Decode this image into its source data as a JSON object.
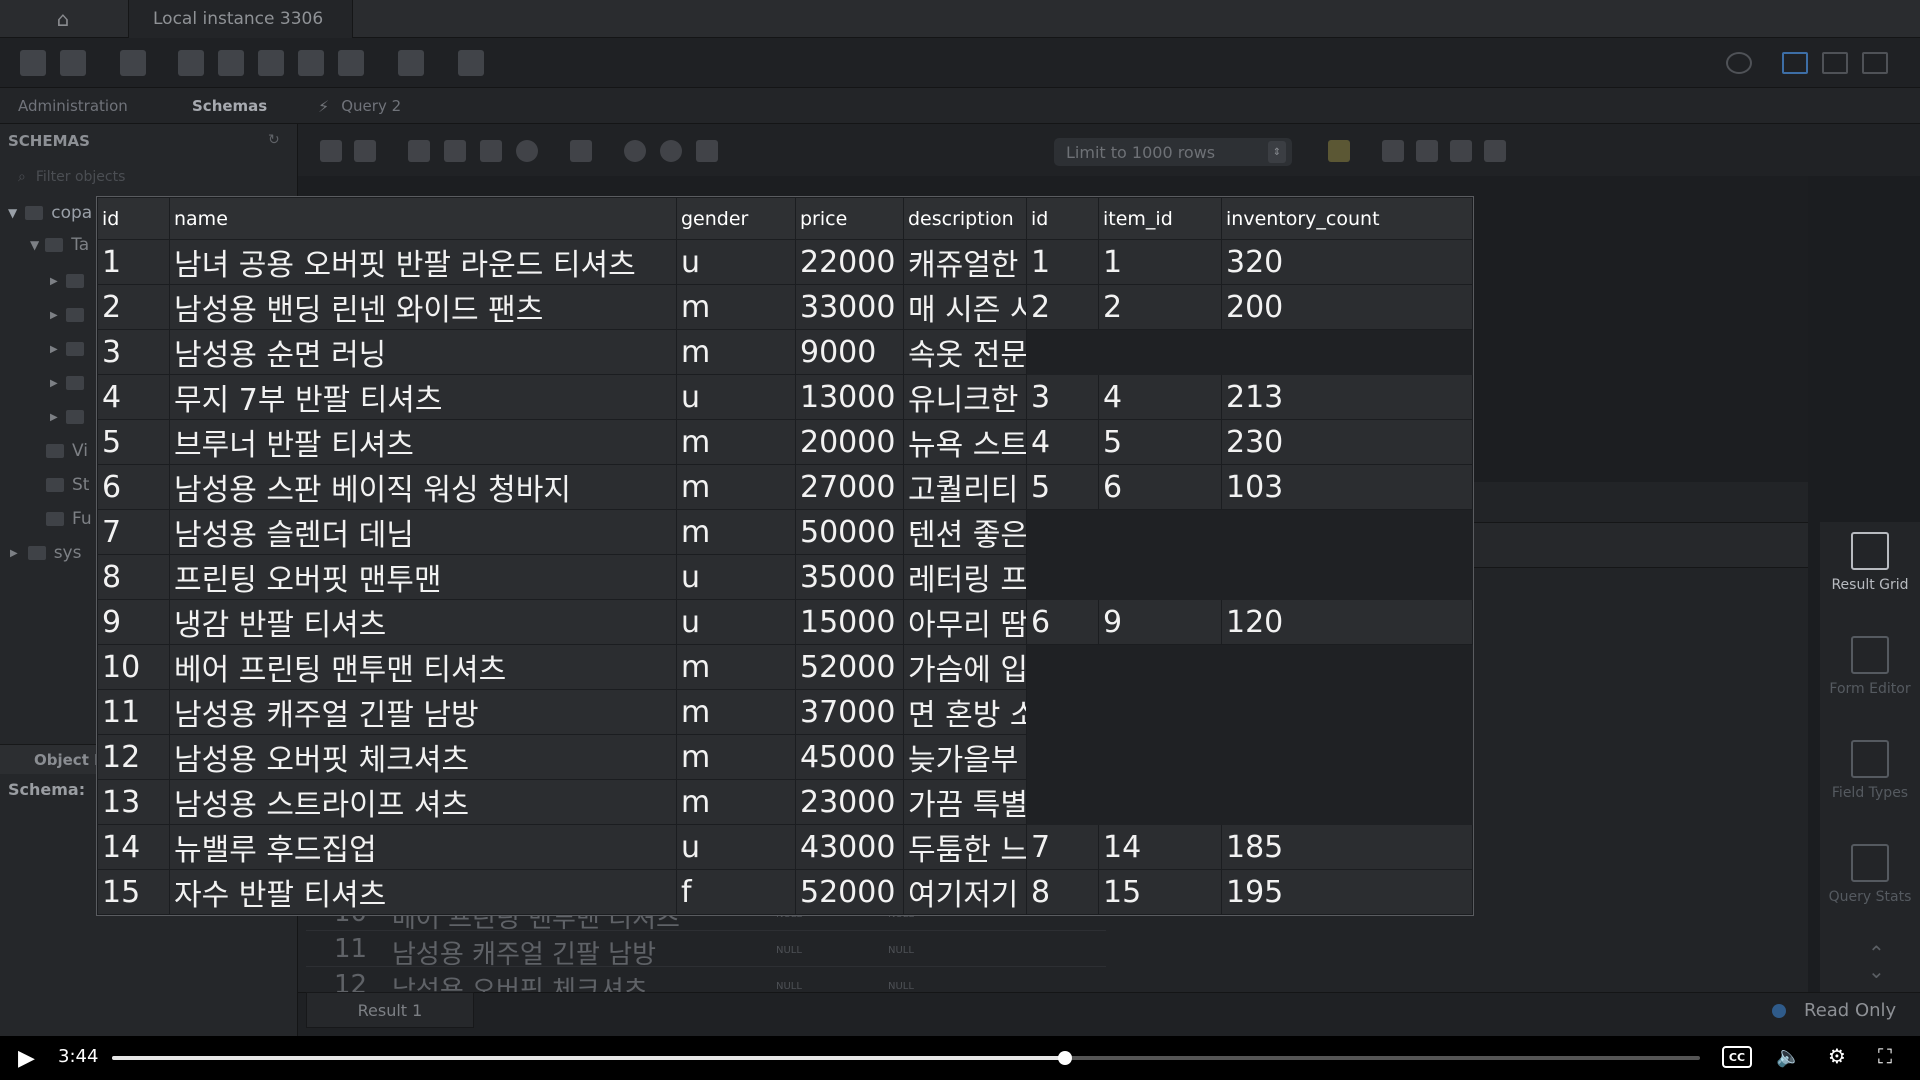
{
  "window": {
    "instance_tab": "Local instance 3306"
  },
  "tabs": [
    {
      "label": "Administration"
    },
    {
      "label": "Schemas"
    },
    {
      "label": "Query 2"
    }
  ],
  "navigator": {
    "header": "SCHEMAS",
    "filter_placeholder": "Filter objects",
    "tree": [
      {
        "label": "copa"
      },
      {
        "label": "Ta"
      },
      {
        "label": "Vi"
      },
      {
        "label": "St"
      },
      {
        "label": "Fu"
      },
      {
        "label": "sys"
      }
    ],
    "object_info_header": "Object I",
    "schema_label": "Schema:"
  },
  "query_toolbar": {
    "limit_label": "Limit to 1000 rows"
  },
  "result_grid": {
    "headers": [
      "id",
      "name",
      "gender",
      "price",
      "description",
      "id",
      "item_id",
      "inventory_count"
    ],
    "rows": [
      [
        "1",
        "남녀 공용 오버핏 반팔 라운드 티셔츠",
        "u",
        "22000",
        "캐쥬얼한",
        "1",
        "1",
        "320"
      ],
      [
        "2",
        "남성용 밴딩 린넨 와이드 팬츠",
        "m",
        "33000",
        "매 시즌 시",
        "2",
        "2",
        "200"
      ],
      [
        "3",
        "남성용 순면 러닝",
        "m",
        "9000",
        "속옷 전문",
        "",
        "",
        ""
      ],
      [
        "4",
        "무지 7부 반팔 티셔츠",
        "u",
        "13000",
        "유니크한",
        "3",
        "4",
        "213"
      ],
      [
        "5",
        "브루너 반팔 티셔츠",
        "m",
        "20000",
        "뉴욕 스트",
        "4",
        "5",
        "230"
      ],
      [
        "6",
        "남성용 스판 베이직 워싱 청바지",
        "m",
        "27000",
        "고퀄리티",
        "5",
        "6",
        "103"
      ],
      [
        "7",
        "남성용 슬렌더 데님",
        "m",
        "50000",
        "텐션 좋은",
        "",
        "",
        ""
      ],
      [
        "8",
        "프린팅 오버핏 맨투맨",
        "u",
        "35000",
        "레터링 프",
        "",
        "",
        ""
      ],
      [
        "9",
        "냉감 반팔 티셔츠",
        "u",
        "15000",
        "아무리 땀",
        "6",
        "9",
        "120"
      ],
      [
        "10",
        "베어 프린팅 맨투맨 티셔츠",
        "m",
        "52000",
        "가슴에 입",
        "",
        "",
        ""
      ],
      [
        "11",
        "남성용 캐주얼 긴팔 남방",
        "m",
        "37000",
        "면 혼방 소",
        "",
        "",
        ""
      ],
      [
        "12",
        "남성용 오버핏 체크셔츠",
        "m",
        "45000",
        "늦가을부",
        "",
        "",
        ""
      ],
      [
        "13",
        "남성용 스트라이프 셔츠",
        "m",
        "23000",
        "가끔 특별",
        "",
        "",
        ""
      ],
      [
        "14",
        "뉴밸루 후드집업",
        "u",
        "43000",
        "두툼한 느",
        "7",
        "14",
        "185"
      ],
      [
        "15",
        "자수 반팔 티셔츠",
        "f",
        "52000",
        "여기저기",
        "8",
        "15",
        "195"
      ]
    ]
  },
  "background_rows": [
    {
      "id": "10",
      "name": "베어 프린팅 맨투맨 티셔츠",
      "c3": "NULL",
      "c4": "NULL"
    },
    {
      "id": "11",
      "name": "남성용 캐주얼 긴팔 남방",
      "c3": "NULL",
      "c4": "NULL"
    },
    {
      "id": "12",
      "name": "남성용 오버핏 체크셔츠",
      "c3": "NULL",
      "c4": "NULL"
    }
  ],
  "side_panel": [
    {
      "label": "Result Grid",
      "icon": "grid-icon"
    },
    {
      "label": "Form Editor",
      "icon": "form-icon"
    },
    {
      "label": "Field Types",
      "icon": "field-icon"
    },
    {
      "label": "Query Stats",
      "icon": "stats-icon"
    }
  ],
  "result_tab": "Result 1",
  "status": {
    "read_only": "Read Only"
  },
  "player": {
    "time": "3:44",
    "progress": 0.6,
    "cc_label": "CC"
  }
}
